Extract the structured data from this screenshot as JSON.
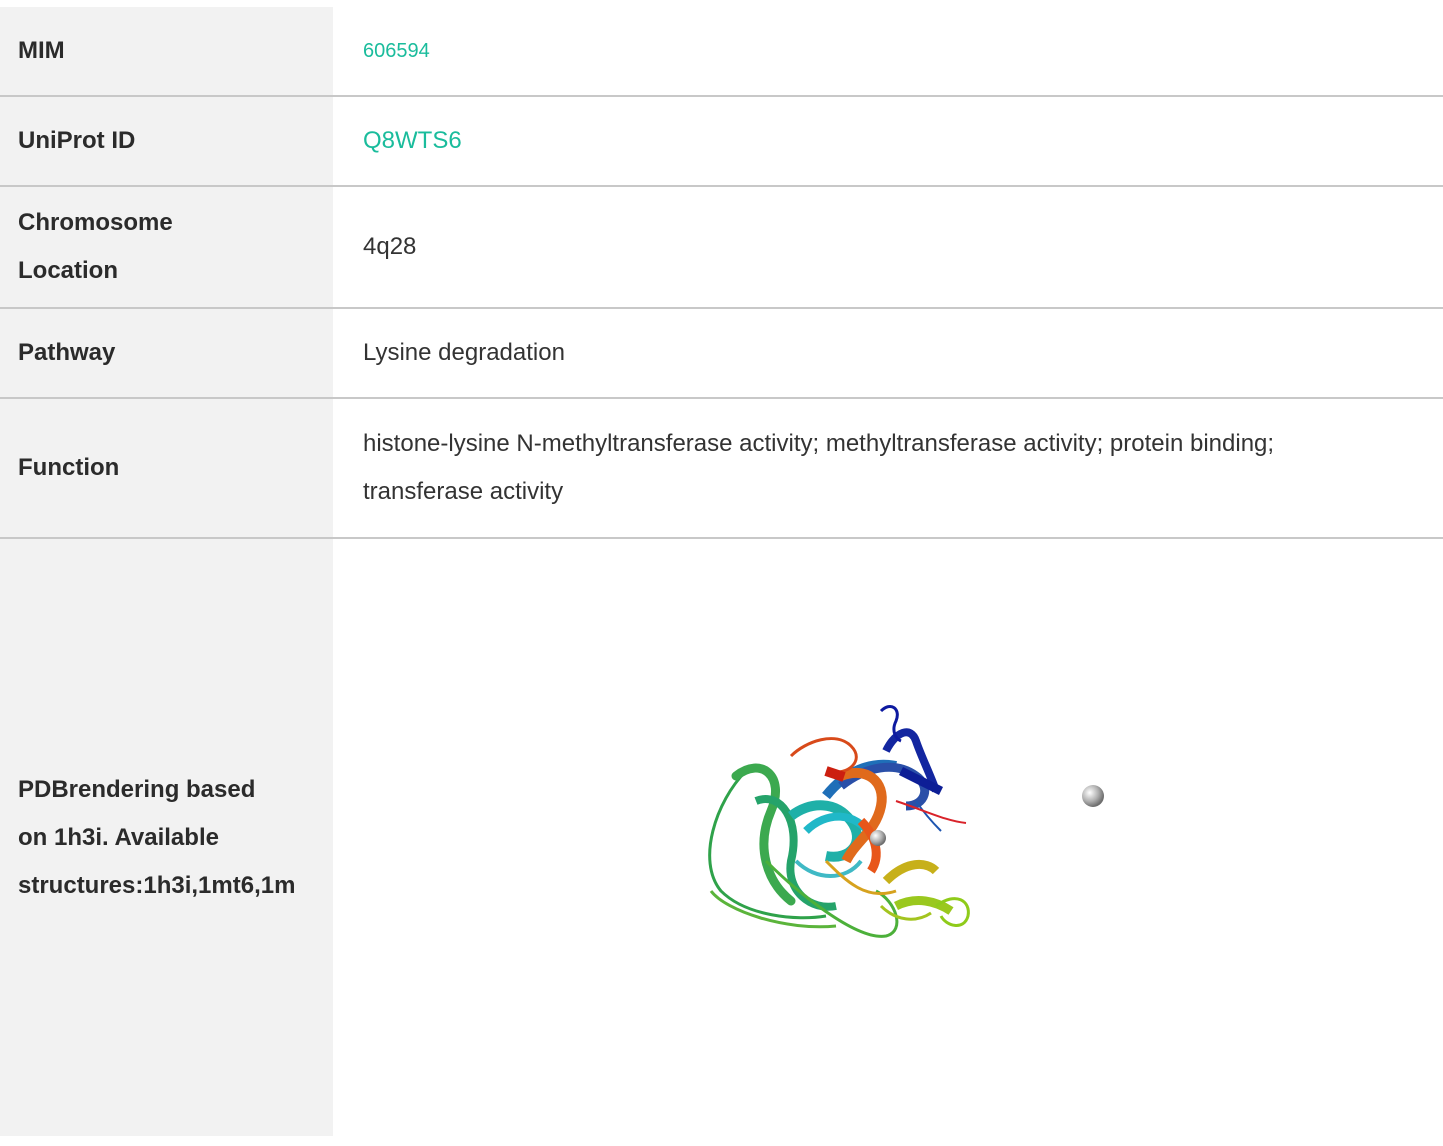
{
  "rows": {
    "mim": {
      "label": "MIM",
      "value": "606594"
    },
    "uniprot": {
      "label": "UniProt ID",
      "value": "Q8WTS6"
    },
    "chromosome": {
      "label_line1": "Chromosome",
      "label_line2": "Location",
      "value": "4q28"
    },
    "pathway": {
      "label": "Pathway",
      "value": "Lysine degradation"
    },
    "function": {
      "label": "Function",
      "value": "histone-lysine N-methyltransferase activity; methyltransferase activity; protein binding; transferase activity"
    },
    "pdb": {
      "label_line1": "PDBrendering based",
      "label_line2": "on 1h3i. Available",
      "label_line3": "structures:1h3i,1mt6,1m",
      "image_icon": "protein-structure-image"
    }
  },
  "colors": {
    "link": "#1abc9c",
    "label_bg": "#f2f2f2",
    "border": "#c8c8c8"
  }
}
